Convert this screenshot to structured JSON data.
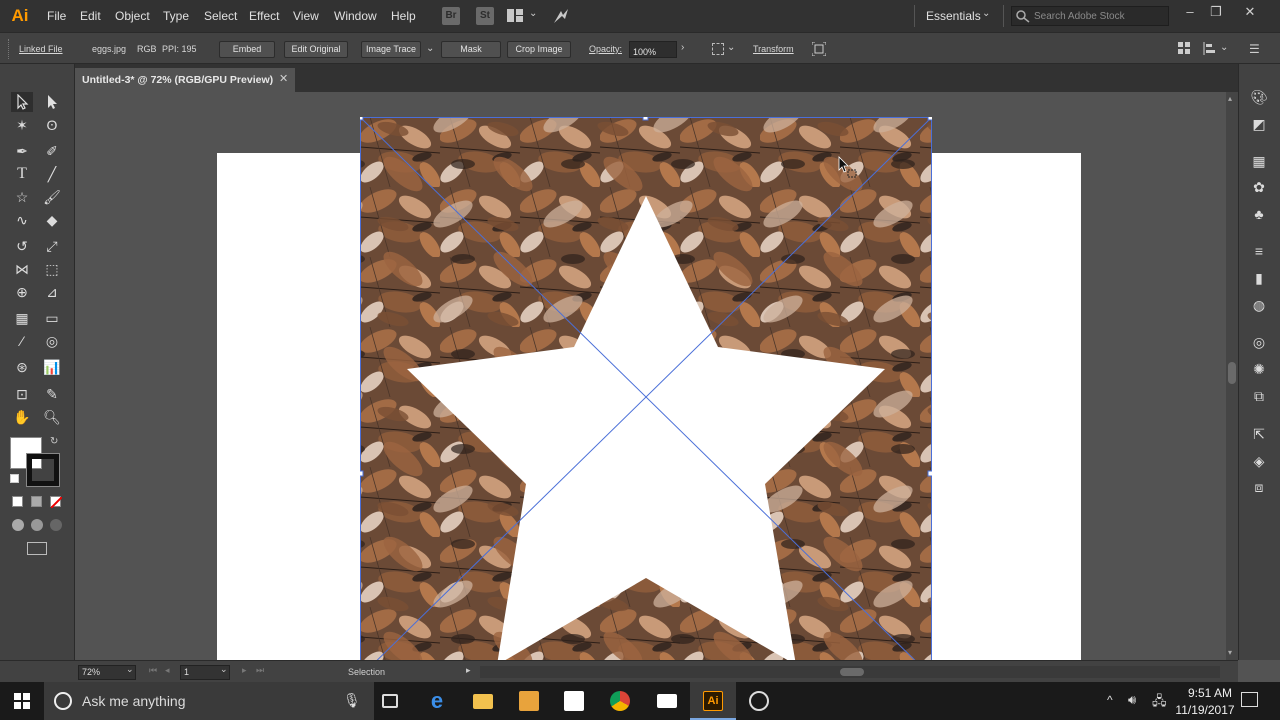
{
  "app": {
    "logo": "Ai",
    "accent": "#ff9a00"
  },
  "menu": [
    "File",
    "Edit",
    "Object",
    "Type",
    "Select",
    "Effect",
    "View",
    "Window",
    "Help"
  ],
  "toolbar_icons": {
    "bridge": "Br",
    "stock": "St"
  },
  "workspace": {
    "label": "Essentials"
  },
  "search": {
    "placeholder": "Search Adobe Stock"
  },
  "control_bar": {
    "linked_file": "Linked File",
    "file_name": "eggs.jpg",
    "color_mode": "RGB",
    "ppi": "PPI: 195",
    "embed": "Embed",
    "edit_original": "Edit Original",
    "image_trace": "Image Trace",
    "mask": "Mask",
    "crop_image": "Crop Image",
    "opacity_label": "Opacity:",
    "opacity_value": "100%",
    "transform": "Transform"
  },
  "document": {
    "tab_title": "Untitled-3* @ 72% (RGB/GPU Preview)",
    "close": "✕"
  },
  "status": {
    "zoom": "72%",
    "page": "1",
    "tool": "Selection"
  },
  "taskbar": {
    "search_text": "Ask me anything",
    "time": "9:51 AM",
    "date": "11/19/2017"
  }
}
